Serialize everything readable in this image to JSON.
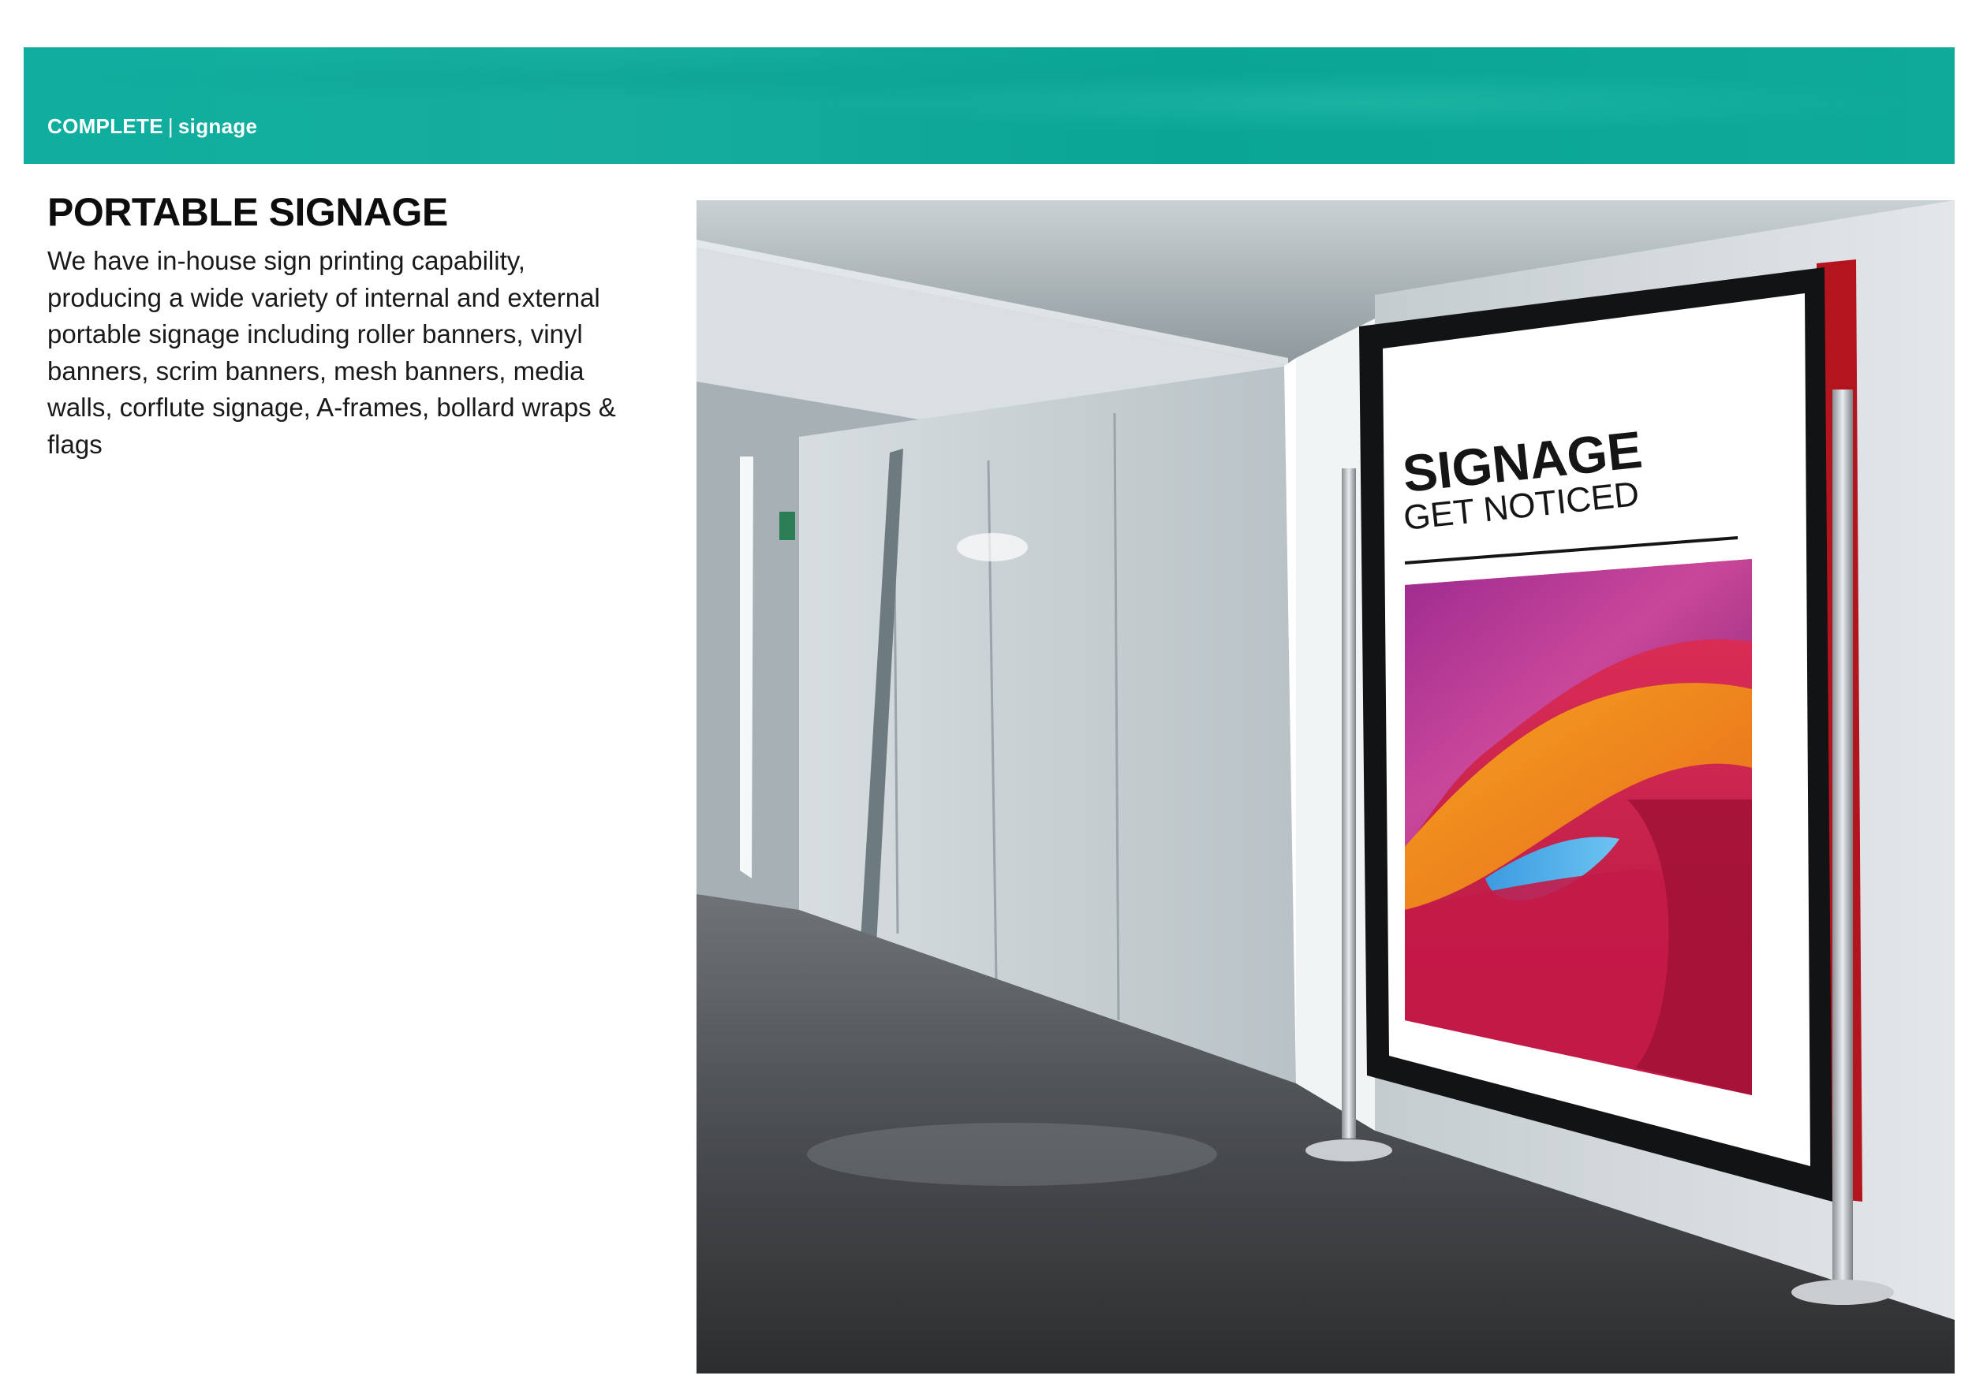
{
  "header": {
    "brand": "COMPLETE",
    "separator": "|",
    "section": "signage",
    "band_color": "#10AC9C"
  },
  "page": {
    "title": "PORTABLE SIGNAGE",
    "body": "We have in-house sign printing capability, producing a wide variety of internal and external portable signage including roller banners, vinyl banners, scrim banners, mesh banners, media walls, corflute signage, A-frames, bollard wraps & flags"
  },
  "photo": {
    "sign_title": "SIGNAGE",
    "sign_subtitle": "GET NOTICED"
  }
}
